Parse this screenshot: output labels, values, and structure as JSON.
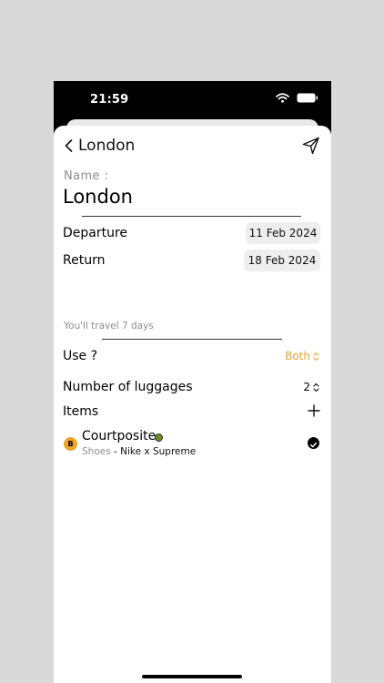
{
  "status_bar": {
    "time": "21:59"
  },
  "nav": {
    "title": "London"
  },
  "name": {
    "label": "Name :",
    "value": "London"
  },
  "departure": {
    "label": "Departure",
    "date": "11 Feb 2024"
  },
  "return": {
    "label": "Return",
    "date": "18 Feb 2024"
  },
  "travel_note": "You'll travel 7 days",
  "use": {
    "label": "Use ?",
    "value": "Both"
  },
  "luggages": {
    "label": "Number of luggages",
    "value": "2"
  },
  "items": {
    "label": "Items",
    "list": [
      {
        "badge": "B",
        "name": "Courtposite",
        "category": "Shoes",
        "separator": " - ",
        "brand": "Nike x Supreme",
        "checked": true,
        "dot_color": "#6b8e23"
      }
    ]
  },
  "colors": {
    "accent": "#e8a43a",
    "badge": "#f1a328",
    "pill_bg": "#eeeeef"
  },
  "icons": [
    "chevron-left-icon",
    "send-icon",
    "wifi-icon",
    "battery-icon",
    "up-down-chevron-icon",
    "plus-icon",
    "checkmark-circle-icon"
  ]
}
